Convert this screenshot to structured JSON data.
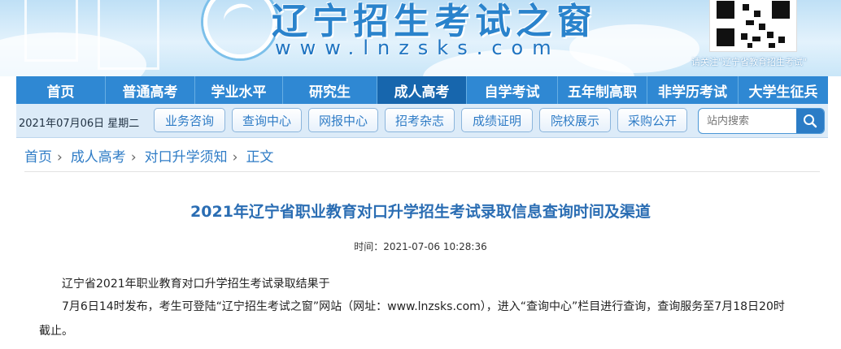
{
  "header": {
    "site_title": "辽宁招生考试之窗",
    "site_domain": "www.lnzsks.com",
    "qr_note": "请关注\"辽宁省教育招生考试\""
  },
  "main_nav": {
    "items": [
      {
        "label": "首页"
      },
      {
        "label": "普通高考"
      },
      {
        "label": "学业水平"
      },
      {
        "label": "研究生"
      },
      {
        "label": "成人高考",
        "active": true
      },
      {
        "label": "自学考试"
      },
      {
        "label": "五年制高职"
      },
      {
        "label": "非学历考试"
      },
      {
        "label": "大学生征兵"
      }
    ]
  },
  "sub_nav": {
    "date": "2021年07月06日 星期二",
    "buttons": [
      "业务咨询",
      "查询中心",
      "网报中心",
      "招考杂志",
      "成绩证明",
      "院校展示",
      "采购公开"
    ],
    "search_placeholder": "站内搜索"
  },
  "breadcrumb": [
    "首页",
    "成人高考",
    "对口升学须知",
    "正文"
  ],
  "breadcrumb_separator": "›",
  "article": {
    "title": "2021年辽宁省职业教育对口升学招生考试录取信息查询时间及渠道",
    "time": "时间：2021-07-06 10:28:36",
    "paragraphs": [
      "辽宁省2021年职业教育对口升学招生考试录取结果于",
      "7月6日14时发布，考生可登陆“辽宁招生考试之窗”网站（网址：www.lnzsks.com），进入“查询中心”栏目进行查询，查询服务至7月18日20时",
      "截止。"
    ]
  },
  "colors": {
    "nav_bg": "#2f88d3",
    "nav_active": "#1766ad",
    "subnav_bg": "#dcebf8",
    "link": "#2f7cc6",
    "title": "#2a6db3"
  }
}
